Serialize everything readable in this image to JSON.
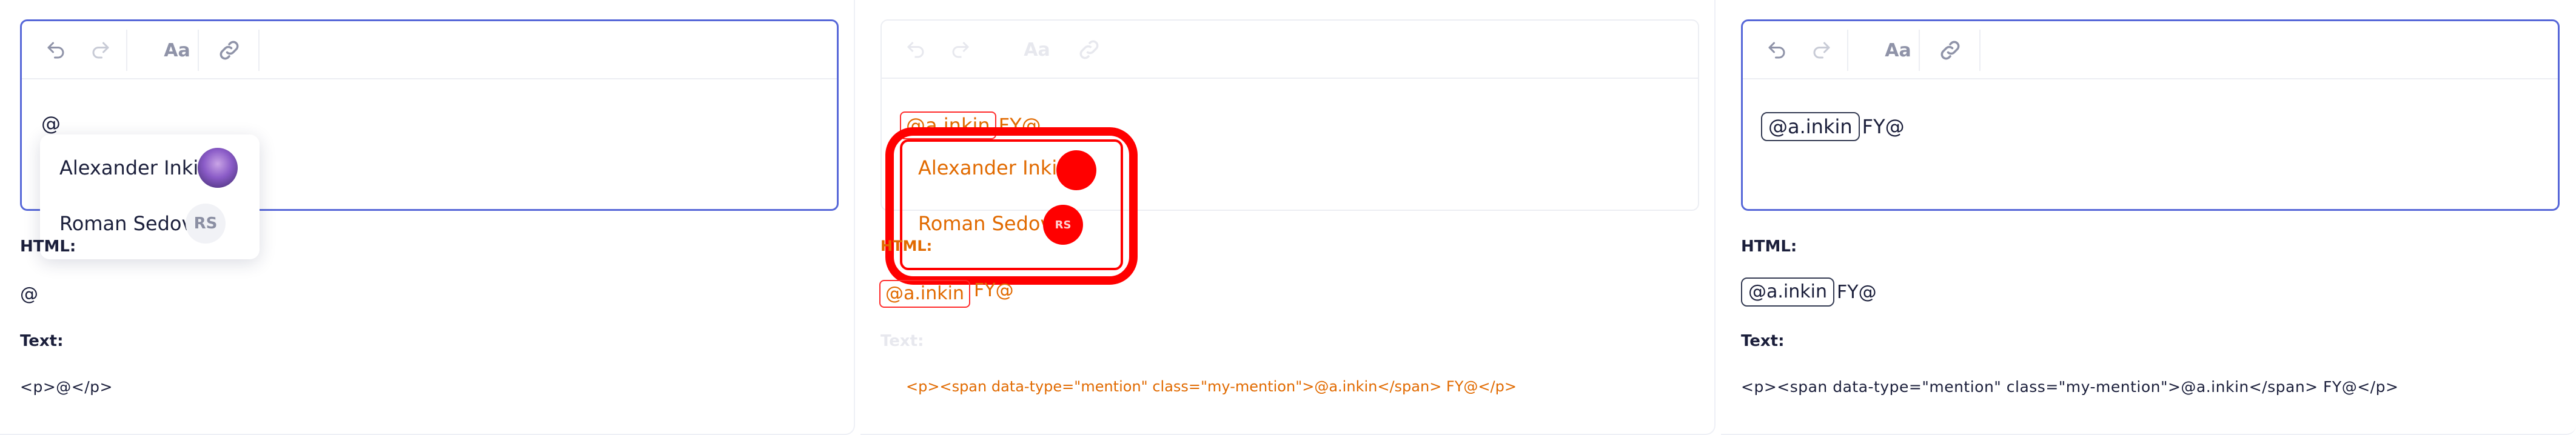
{
  "toolbar": {
    "undo_icon": "undo-icon",
    "redo_icon": "redo-icon",
    "text_style_label": "Aa",
    "link_icon": "link-icon"
  },
  "panels": {
    "left": {
      "content": "@",
      "suggestions": [
        {
          "name": "Alexander Inkin",
          "avatar": "photo"
        },
        {
          "name": "Roman Sedov",
          "avatar_initials": "RS"
        }
      ],
      "html_label": "HTML:",
      "html_value": "@",
      "text_label": "Text:",
      "text_value": "<p>@</p>"
    },
    "middle": {
      "mention": "@a.inkin",
      "trailing": "FY@",
      "suggestions": [
        {
          "name": "Alexander Inkin"
        },
        {
          "name": "Roman Sedov",
          "avatar_initials": "RS"
        }
      ],
      "html_label": "HTML:",
      "html_mention": "@a.inkin",
      "html_trailing": "FY@",
      "text_label": "Text:",
      "text_value": "<p><span data-type=\"mention\" class=\"my-mention\">@a.inkin</span> FY@</p>"
    },
    "right": {
      "mention": "@a.inkin",
      "trailing": "FY@",
      "html_label": "HTML:",
      "html_mention": "@a.inkin",
      "html_trailing": "FY@",
      "text_label": "Text:",
      "text_value": "<p><span data-type=\"mention\" class=\"my-mention\">@a.inkin</span> FY@</p>"
    }
  },
  "colors": {
    "focus_border": "#5667d8",
    "diff_red": "#ff0000",
    "diff_orange": "#e16a00",
    "text": "#1b1f3b"
  }
}
